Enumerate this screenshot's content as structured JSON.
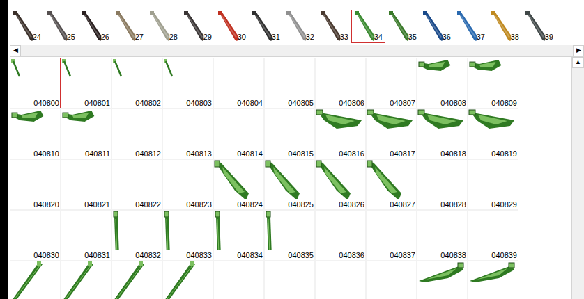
{
  "strip": {
    "items": [
      {
        "label": "24",
        "selected": false,
        "color": "#3b302a"
      },
      {
        "label": "25",
        "selected": false,
        "color": "#555050"
      },
      {
        "label": "26",
        "selected": false,
        "color": "#2a2020"
      },
      {
        "label": "27",
        "selected": false,
        "color": "#8a7a60"
      },
      {
        "label": "28",
        "selected": false,
        "color": "#a0a090"
      },
      {
        "label": "29",
        "selected": false,
        "color": "#3a3535"
      },
      {
        "label": "30",
        "selected": false,
        "color": "#c03020"
      },
      {
        "label": "31",
        "selected": false,
        "color": "#303030"
      },
      {
        "label": "32",
        "selected": false,
        "color": "#909090"
      },
      {
        "label": "33",
        "selected": false,
        "color": "#4a3a30"
      },
      {
        "label": "34",
        "selected": true,
        "color": "#3a8a30"
      },
      {
        "label": "35",
        "selected": false,
        "color": "#3a7a2a"
      },
      {
        "label": "36",
        "selected": false,
        "color": "#1a4a8a"
      },
      {
        "label": "37",
        "selected": false,
        "color": "#2a6ab0"
      },
      {
        "label": "38",
        "selected": false,
        "color": "#c08a20"
      },
      {
        "label": "39",
        "selected": false,
        "color": "#404848"
      }
    ]
  },
  "hscroll": {
    "left": "◀",
    "right": "▶"
  },
  "vscroll": {
    "up": "▲"
  },
  "grid": {
    "cells": [
      {
        "label": "040800",
        "selected": true,
        "kind": "small"
      },
      {
        "label": "040801",
        "selected": false,
        "kind": "small"
      },
      {
        "label": "040802",
        "selected": false,
        "kind": "small"
      },
      {
        "label": "040803",
        "selected": false,
        "kind": "small"
      },
      {
        "label": "040804",
        "selected": false,
        "kind": "none"
      },
      {
        "label": "040805",
        "selected": false,
        "kind": "none"
      },
      {
        "label": "040806",
        "selected": false,
        "kind": "none"
      },
      {
        "label": "040807",
        "selected": false,
        "kind": "none"
      },
      {
        "label": "040808",
        "selected": false,
        "kind": "flag"
      },
      {
        "label": "040809",
        "selected": false,
        "kind": "flag"
      },
      {
        "label": "040810",
        "selected": false,
        "kind": "flag"
      },
      {
        "label": "040811",
        "selected": false,
        "kind": "flag"
      },
      {
        "label": "040812",
        "selected": false,
        "kind": "none"
      },
      {
        "label": "040813",
        "selected": false,
        "kind": "none"
      },
      {
        "label": "040814",
        "selected": false,
        "kind": "none"
      },
      {
        "label": "040815",
        "selected": false,
        "kind": "none"
      },
      {
        "label": "040816",
        "selected": false,
        "kind": "slant"
      },
      {
        "label": "040817",
        "selected": false,
        "kind": "slant"
      },
      {
        "label": "040818",
        "selected": false,
        "kind": "slant"
      },
      {
        "label": "040819",
        "selected": false,
        "kind": "slant"
      },
      {
        "label": "040820",
        "selected": false,
        "kind": "none"
      },
      {
        "label": "040821",
        "selected": false,
        "kind": "none"
      },
      {
        "label": "040822",
        "selected": false,
        "kind": "none"
      },
      {
        "label": "040823",
        "selected": false,
        "kind": "none"
      },
      {
        "label": "040824",
        "selected": false,
        "kind": "diag"
      },
      {
        "label": "040825",
        "selected": false,
        "kind": "diag"
      },
      {
        "label": "040826",
        "selected": false,
        "kind": "diag"
      },
      {
        "label": "040827",
        "selected": false,
        "kind": "diag"
      },
      {
        "label": "040828",
        "selected": false,
        "kind": "none"
      },
      {
        "label": "040829",
        "selected": false,
        "kind": "none"
      },
      {
        "label": "040830",
        "selected": false,
        "kind": "none"
      },
      {
        "label": "040831",
        "selected": false,
        "kind": "none"
      },
      {
        "label": "040832",
        "selected": false,
        "kind": "vertical"
      },
      {
        "label": "040833",
        "selected": false,
        "kind": "vertical"
      },
      {
        "label": "040834",
        "selected": false,
        "kind": "vertical"
      },
      {
        "label": "040835",
        "selected": false,
        "kind": "vertical"
      },
      {
        "label": "040836",
        "selected": false,
        "kind": "none"
      },
      {
        "label": "040837",
        "selected": false,
        "kind": "none"
      },
      {
        "label": "040838",
        "selected": false,
        "kind": "none"
      },
      {
        "label": "040839",
        "selected": false,
        "kind": "none"
      },
      {
        "selected": false,
        "kind": "long"
      },
      {
        "selected": false,
        "kind": "long"
      },
      {
        "selected": false,
        "kind": "long"
      },
      {
        "selected": false,
        "kind": "long"
      },
      {
        "selected": false,
        "kind": "none"
      },
      {
        "selected": false,
        "kind": "none"
      },
      {
        "selected": false,
        "kind": "none"
      },
      {
        "selected": false,
        "kind": "none"
      },
      {
        "selected": false,
        "kind": "flat"
      },
      {
        "selected": false,
        "kind": "flat"
      }
    ]
  }
}
